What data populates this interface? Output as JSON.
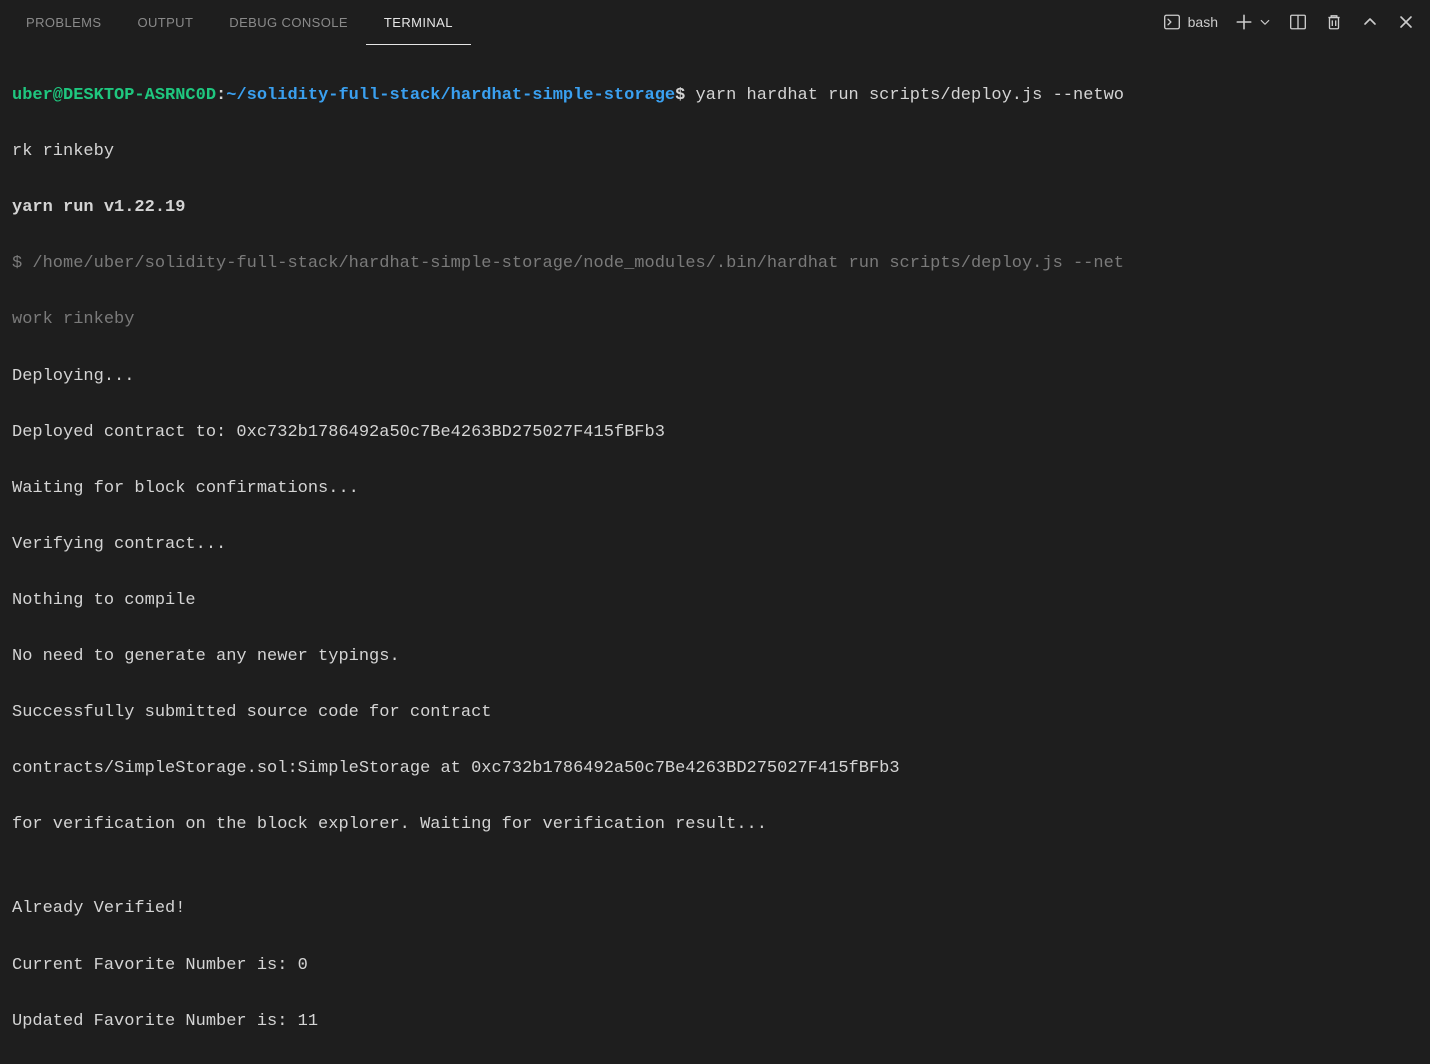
{
  "tabs": {
    "problems": "PROBLEMS",
    "output": "OUTPUT",
    "debug_console": "DEBUG CONSOLE",
    "terminal": "TERMINAL"
  },
  "toolbar": {
    "shell_name": "bash"
  },
  "terminal": {
    "prompt": {
      "user": "uber@DESKTOP-ASRNC0D",
      "sep": ":",
      "path": "~/solidity-full-stack/hardhat-simple-storage",
      "dollar": "$"
    },
    "command_part1": " yarn hardhat run scripts/deploy.js --netwo",
    "command_part2": "rk rinkeby",
    "yarn_line": "yarn run v1.22.19",
    "sub_prefix": "$ ",
    "sub_cmd_part1": "/home/uber/solidity-full-stack/hardhat-simple-storage/node_modules/.bin/hardhat run scripts/deploy.js --net",
    "sub_cmd_part2": "work rinkeby",
    "out_deploying": "Deploying...",
    "out_deployed": "Deployed contract to: 0xc732b1786492a50c7Be4263BD275027F415fBFb3",
    "out_waiting": "Waiting for block confirmations...",
    "out_verifying": "Verifying contract...",
    "out_nothing": "Nothing to compile",
    "out_typings": "No need to generate any newer typings.",
    "out_submitted": "Successfully submitted source code for contract",
    "out_contract_path": "contracts/SimpleStorage.sol:SimpleStorage at 0xc732b1786492a50c7Be4263BD275027F415fBFb3",
    "out_for_verif": "for verification on the block explorer. Waiting for verification result...",
    "out_blank": "",
    "out_already": "Already Verified!",
    "out_current": "Current Favorite Number is: 0",
    "out_updated": "Updated Favorite Number is: 11"
  }
}
